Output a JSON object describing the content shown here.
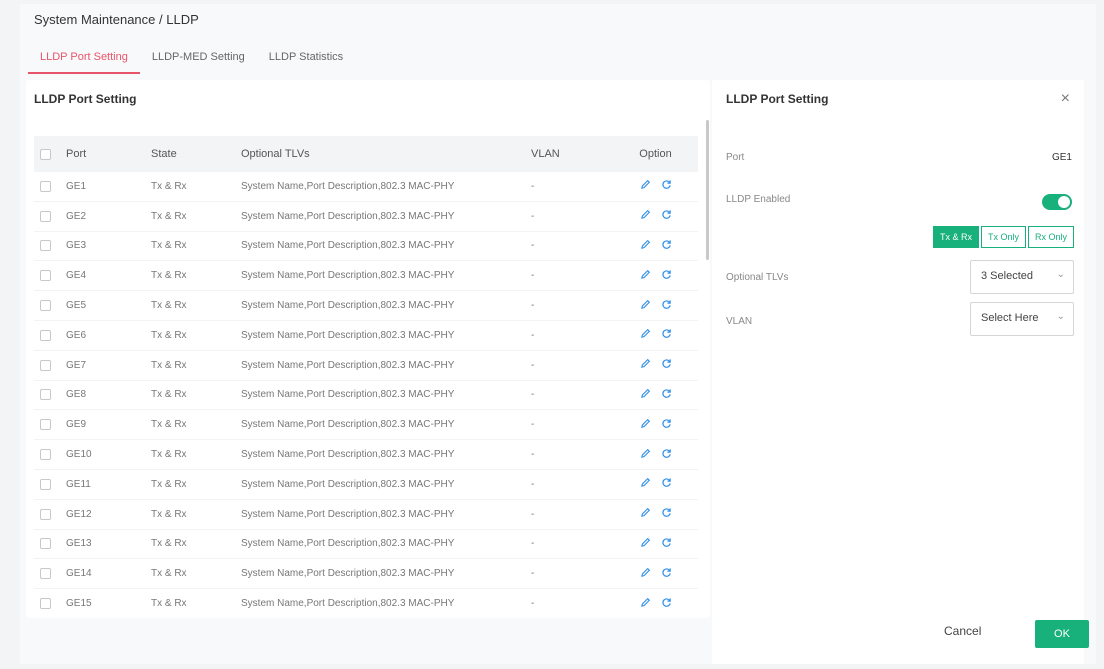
{
  "breadcrumb": "System Maintenance / LLDP",
  "tabs": [
    {
      "label": "LLDP Port Setting",
      "active": true
    },
    {
      "label": "LLDP-MED Setting",
      "active": false
    },
    {
      "label": "LLDP Statistics",
      "active": false
    }
  ],
  "left_panel": {
    "title": "LLDP Port Setting",
    "columns": {
      "port": "Port",
      "state": "State",
      "tlvs": "Optional TLVs",
      "vlan": "VLAN",
      "option": "Option"
    },
    "rows": [
      {
        "port": "GE1",
        "state": "Tx & Rx",
        "tlvs": "System Name,Port Description,802.3 MAC-PHY",
        "vlan": "-"
      },
      {
        "port": "GE2",
        "state": "Tx & Rx",
        "tlvs": "System Name,Port Description,802.3 MAC-PHY",
        "vlan": "-"
      },
      {
        "port": "GE3",
        "state": "Tx & Rx",
        "tlvs": "System Name,Port Description,802.3 MAC-PHY",
        "vlan": "-"
      },
      {
        "port": "GE4",
        "state": "Tx & Rx",
        "tlvs": "System Name,Port Description,802.3 MAC-PHY",
        "vlan": "-"
      },
      {
        "port": "GE5",
        "state": "Tx & Rx",
        "tlvs": "System Name,Port Description,802.3 MAC-PHY",
        "vlan": "-"
      },
      {
        "port": "GE6",
        "state": "Tx & Rx",
        "tlvs": "System Name,Port Description,802.3 MAC-PHY",
        "vlan": "-"
      },
      {
        "port": "GE7",
        "state": "Tx & Rx",
        "tlvs": "System Name,Port Description,802.3 MAC-PHY",
        "vlan": "-"
      },
      {
        "port": "GE8",
        "state": "Tx & Rx",
        "tlvs": "System Name,Port Description,802.3 MAC-PHY",
        "vlan": "-"
      },
      {
        "port": "GE9",
        "state": "Tx & Rx",
        "tlvs": "System Name,Port Description,802.3 MAC-PHY",
        "vlan": "-"
      },
      {
        "port": "GE10",
        "state": "Tx & Rx",
        "tlvs": "System Name,Port Description,802.3 MAC-PHY",
        "vlan": "-"
      },
      {
        "port": "GE11",
        "state": "Tx & Rx",
        "tlvs": "System Name,Port Description,802.3 MAC-PHY",
        "vlan": "-"
      },
      {
        "port": "GE12",
        "state": "Tx & Rx",
        "tlvs": "System Name,Port Description,802.3 MAC-PHY",
        "vlan": "-"
      },
      {
        "port": "GE13",
        "state": "Tx & Rx",
        "tlvs": "System Name,Port Description,802.3 MAC-PHY",
        "vlan": "-"
      },
      {
        "port": "GE14",
        "state": "Tx & Rx",
        "tlvs": "System Name,Port Description,802.3 MAC-PHY",
        "vlan": "-"
      },
      {
        "port": "GE15",
        "state": "Tx & Rx",
        "tlvs": "System Name,Port Description,802.3 MAC-PHY",
        "vlan": "-"
      }
    ],
    "icons": {
      "edit": "pencil-icon",
      "reset": "refresh-icon"
    }
  },
  "right_panel": {
    "title": "LLDP Port Setting",
    "close": "×",
    "port_label": "Port",
    "port_value": "GE1",
    "enabled_label": "LLDP Enabled",
    "enabled": true,
    "modes": [
      {
        "label": "Tx & Rx",
        "active": true
      },
      {
        "label": "Tx Only",
        "active": false
      },
      {
        "label": "Rx Only",
        "active": false
      }
    ],
    "tlvs_label": "Optional TLVs",
    "tlvs_value": "3 Selected",
    "vlan_label": "VLAN",
    "vlan_placeholder": "Select Here",
    "cancel": "Cancel",
    "ok": "OK"
  },
  "colors": {
    "accent": "#18b07b",
    "tab_active": "#e8556a",
    "icon_blue": "#2f8fe8"
  }
}
